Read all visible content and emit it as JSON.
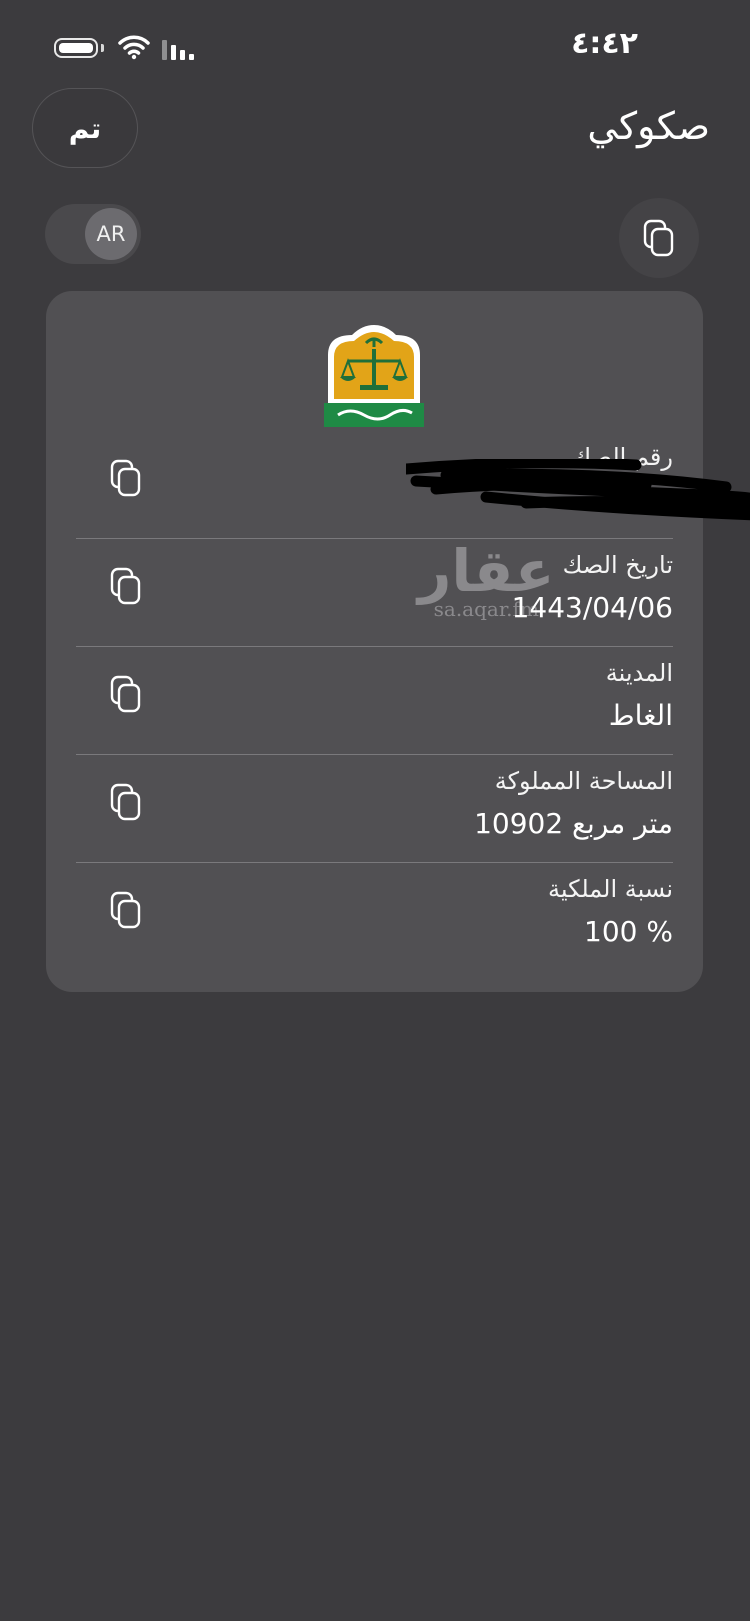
{
  "status_bar": {
    "time": "٤:٤٢"
  },
  "header": {
    "done_label": "تم",
    "title": "صكوكي"
  },
  "toolbar": {
    "lang_label": "AR"
  },
  "deed": {
    "fields": [
      {
        "label": "رقم الصك",
        "value": ""
      },
      {
        "label": "تاريخ الصك",
        "value": "1443/04/06"
      },
      {
        "label": "المدينة",
        "value": "الغاط"
      },
      {
        "label": "المساحة المملوكة",
        "value": "10902 متر مربع"
      },
      {
        "label": "نسبة الملكية",
        "value": "100 %"
      }
    ]
  },
  "watermark": {
    "arabic": "عقار",
    "url": "sa.aqar.fm"
  }
}
